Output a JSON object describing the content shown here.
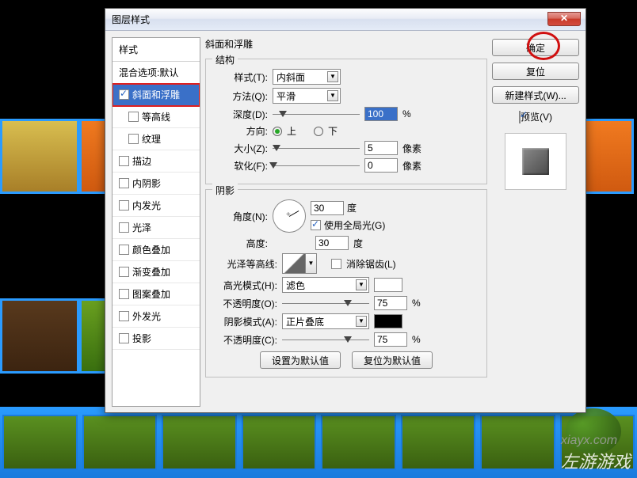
{
  "dialog": {
    "title": "图层样式",
    "close": "✕"
  },
  "styles_list": {
    "header": "样式",
    "blend_defaults": "混合选项:默认",
    "items": [
      {
        "label": "斜面和浮雕",
        "checked": true,
        "selected": true,
        "red": true
      },
      {
        "label": "等高线",
        "checked": false,
        "sub": true
      },
      {
        "label": "纹理",
        "checked": false,
        "sub": true
      },
      {
        "label": "描边",
        "checked": false
      },
      {
        "label": "内阴影",
        "checked": false
      },
      {
        "label": "内发光",
        "checked": false
      },
      {
        "label": "光泽",
        "checked": false
      },
      {
        "label": "颜色叠加",
        "checked": false
      },
      {
        "label": "渐变叠加",
        "checked": false
      },
      {
        "label": "图案叠加",
        "checked": false
      },
      {
        "label": "外发光",
        "checked": false
      },
      {
        "label": "投影",
        "checked": false
      }
    ]
  },
  "bevel": {
    "panel_label": "斜面和浮雕",
    "structure_label": "结构",
    "style_lbl": "样式(T):",
    "style_val": "内斜面",
    "method_lbl": "方法(Q):",
    "method_val": "平滑",
    "depth_lbl": "深度(D):",
    "depth_val": "100",
    "depth_unit": "%",
    "direction_lbl": "方向:",
    "dir_up": "上",
    "dir_down": "下",
    "size_lbl": "大小(Z):",
    "size_val": "5",
    "px": "像素",
    "soften_lbl": "软化(F):",
    "soften_val": "0"
  },
  "shading": {
    "label": "阴影",
    "angle_lbl": "角度(N):",
    "angle_val": "30",
    "degree": "度",
    "global_light": "使用全局光(G)",
    "altitude_lbl": "高度:",
    "altitude_val": "30",
    "gloss_contour_lbl": "光泽等高线:",
    "antialias": "消除锯齿(L)",
    "highlight_mode_lbl": "高光模式(H):",
    "highlight_mode_val": "滤色",
    "highlight_opacity_lbl": "不透明度(O):",
    "highlight_opacity_val": "75",
    "pct": "%",
    "shadow_mode_lbl": "阴影模式(A):",
    "shadow_mode_val": "正片叠底",
    "shadow_opacity_lbl": "不透明度(C):",
    "shadow_opacity_val": "75"
  },
  "footer": {
    "make_default": "设置为默认值",
    "reset_default": "复位为默认值"
  },
  "right": {
    "ok": "确定",
    "cancel": "复位",
    "new_style": "新建样式(W)...",
    "preview": "预览(V)"
  },
  "watermark": {
    "site": "xiayx.com",
    "brand": "左游游戏"
  }
}
